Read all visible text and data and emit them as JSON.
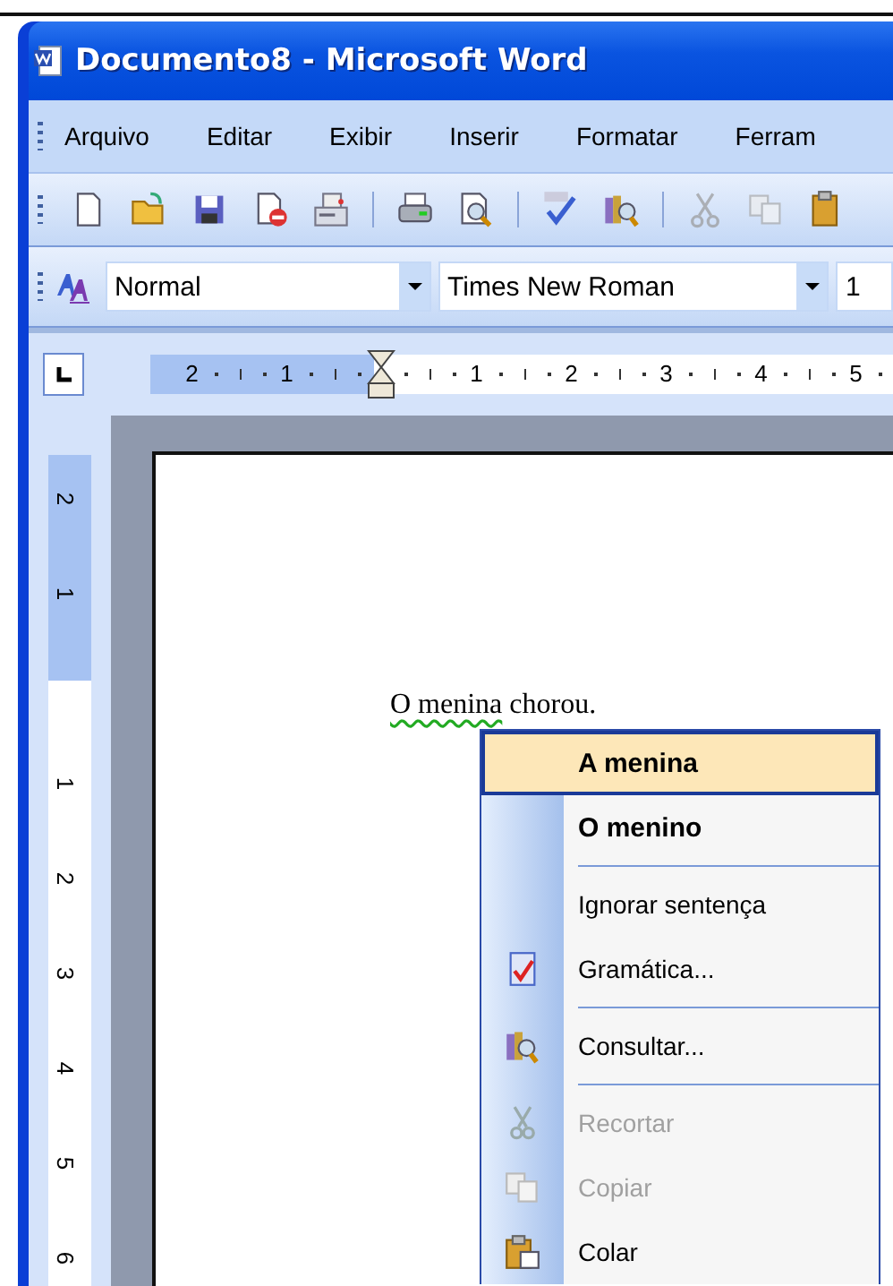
{
  "window": {
    "title": "Documento8 - Microsoft Word"
  },
  "menu_bar": [
    "Arquivo",
    "Editar",
    "Exibir",
    "Inserir",
    "Formatar",
    "Ferram"
  ],
  "formatting": {
    "style": "Normal",
    "font": "Times New Roman",
    "size": "1"
  },
  "horizontal_ruler": {
    "left_labels": [
      "2",
      "1"
    ],
    "right_labels": [
      "1",
      "2",
      "3",
      "4",
      "5"
    ]
  },
  "vertical_ruler": {
    "top_labels": [
      "2",
      "1"
    ],
    "bottom_labels": [
      "1",
      "2",
      "3",
      "4",
      "5",
      "6"
    ]
  },
  "document": {
    "grammar_error": true,
    "segments": [
      {
        "text": "O menina"
      },
      {
        "text": " chorou."
      }
    ]
  },
  "context_menu": [
    {
      "kind": "suggestion",
      "label": "A menina",
      "selected": true
    },
    {
      "kind": "suggestion",
      "label": "O menino",
      "selected": false
    },
    {
      "kind": "separator"
    },
    {
      "kind": "command",
      "label": "Ignorar sentença",
      "disabled": false
    },
    {
      "kind": "command",
      "label": "Gramática...",
      "disabled": false
    },
    {
      "kind": "separator"
    },
    {
      "kind": "command",
      "label": "Consultar...",
      "disabled": false
    },
    {
      "kind": "separator"
    },
    {
      "kind": "command",
      "label": "Recortar",
      "disabled": true
    },
    {
      "kind": "command",
      "label": "Copiar",
      "disabled": true
    },
    {
      "kind": "command",
      "label": "Colar",
      "disabled": false
    }
  ]
}
